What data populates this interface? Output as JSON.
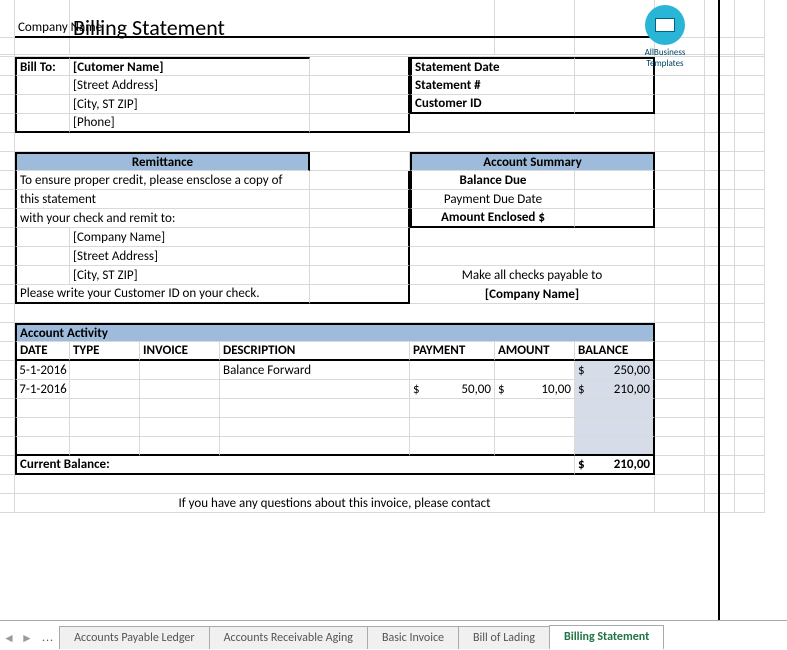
{
  "title": "Billing Statement",
  "logo": {
    "line1": "AllBusiness",
    "line2": "Templates"
  },
  "companyNameLabel": "Company Name",
  "billTo": {
    "label": "Bill To:",
    "customer": "[Cutomer Name]",
    "street": "[Street Address]",
    "cityzip": "[City, ST ZIP]",
    "phone": "[Phone]"
  },
  "statement": {
    "dateLabel": "Statement Date",
    "numberLabel": "Statement #",
    "customerIdLabel": "Customer ID"
  },
  "remittance": {
    "header": "Remittance",
    "line1": "To ensure proper credit, please ensclose a copy of",
    "line1b": "this statement",
    "line2": "with your check and remit to:",
    "company": "[Company Name]",
    "street": "[Street Address]",
    "cityzip": "[City, ST ZIP]",
    "footer": "Please write your Customer ID on your check."
  },
  "accountSummary": {
    "header": "Account Summary",
    "balanceDue": "Balance Due",
    "paymentDueDate": "Payment Due Date",
    "amountEnclosed": "Amount Enclosed $",
    "payableText": "Make all checks payable to",
    "payableName": "[Company Name]"
  },
  "activity": {
    "header": "Account Activity",
    "cols": {
      "date": "DATE",
      "type": "TYPE",
      "invoice": "INVOICE",
      "desc": "DESCRIPTION",
      "payment": "PAYMENT",
      "amount": "AMOUNT",
      "balance": "BALANCE"
    },
    "rows": [
      {
        "date": "5-1-2016",
        "type": "",
        "invoice": "",
        "desc": "Balance Forward",
        "payment": "",
        "pay_amt": "",
        "amount": "",
        "amt_sym": "",
        "bal_sym": "$",
        "balance": "250,00"
      },
      {
        "date": "7-1-2016",
        "type": "",
        "invoice": "",
        "desc": "",
        "payment": "$",
        "pay_amt": "50,00",
        "amt_sym": "$",
        "amount": "10,00",
        "bal_sym": "$",
        "balance": "210,00"
      }
    ],
    "currentBalanceLabel": "Current Balance:",
    "currentBalanceSym": "$",
    "currentBalanceVal": "210,00"
  },
  "footer": "If you have any questions about this invoice, please contact",
  "tabs": {
    "prev": "...",
    "items": [
      "Accounts Payable Ledger",
      "Accounts Receivable Aging",
      "Basic Invoice",
      "Bill of Lading",
      "Billing Statement"
    ],
    "active": 4
  }
}
